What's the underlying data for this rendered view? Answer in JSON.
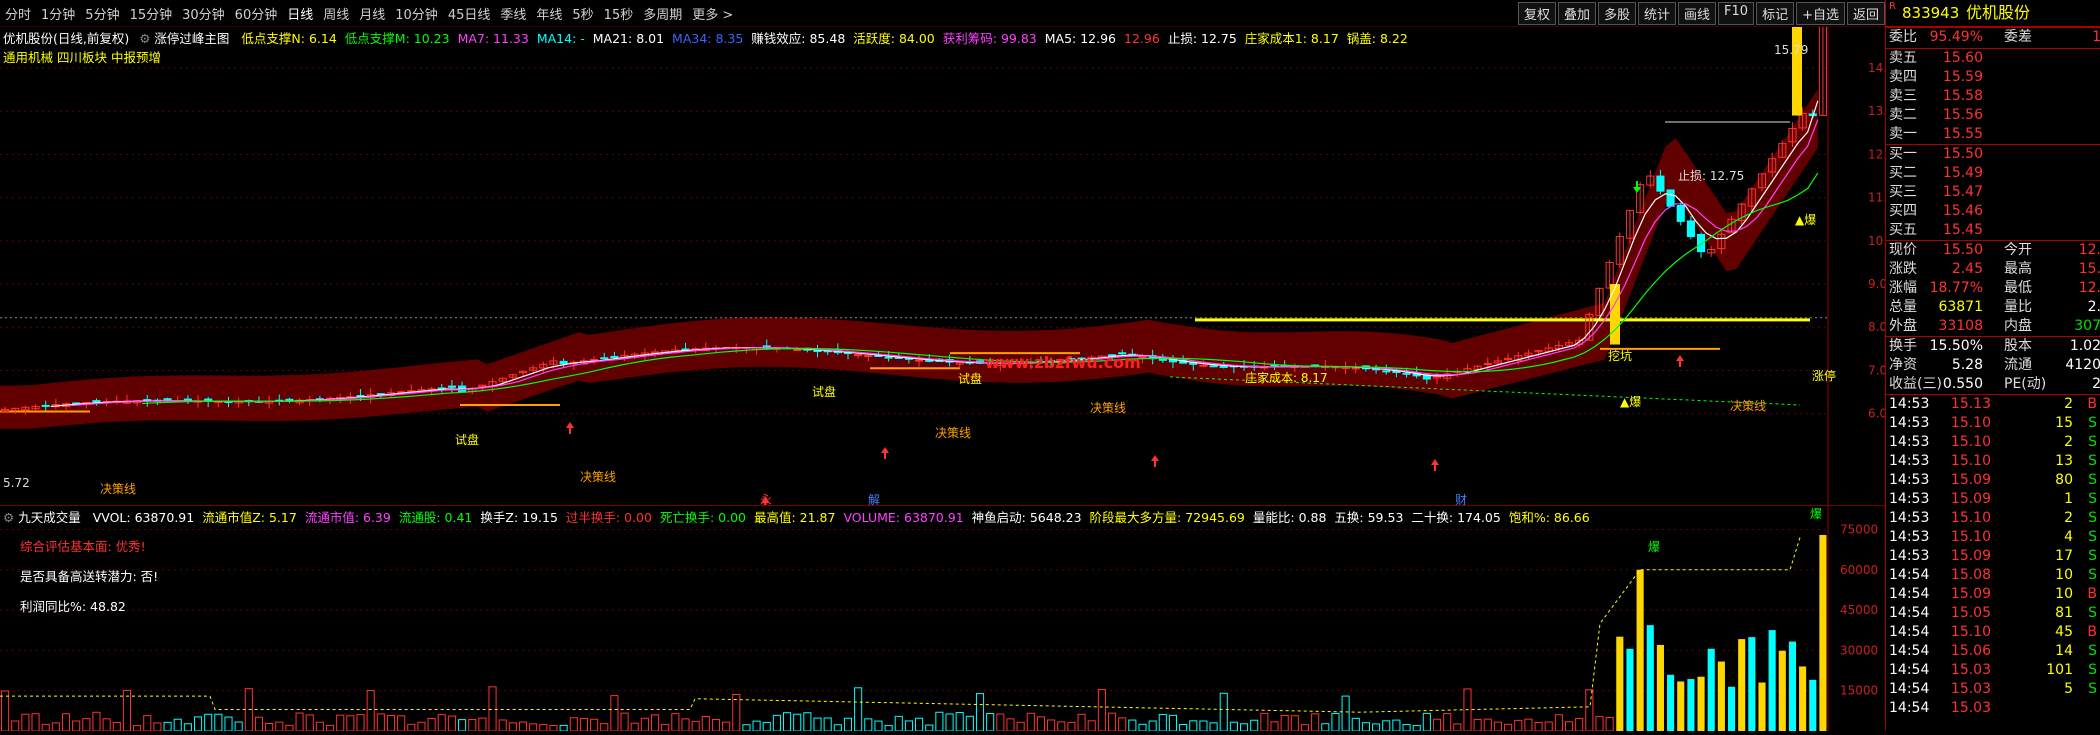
{
  "toolbar": {
    "periods": [
      "分时",
      "1分钟",
      "5分钟",
      "15分钟",
      "30分钟",
      "60分钟",
      "日线",
      "周线",
      "月线",
      "10分钟",
      "45日线",
      "季线",
      "年线",
      "5秒",
      "15秒",
      "多周期",
      "更多 >"
    ],
    "active": "日线",
    "right_buttons": [
      "复权",
      "叠加",
      "多股",
      "统计",
      "画线",
      "F10",
      "标记",
      "+自选",
      "返回"
    ]
  },
  "main": {
    "title": "优机股份(日线,前复权)",
    "formula": "涨停过峰主图",
    "indicators": [
      {
        "text": "低点支撑N: 6.14",
        "color": "#ffff00"
      },
      {
        "text": "低点支撑M: 10.23",
        "color": "#00ff00"
      },
      {
        "text": "MA7: 11.33",
        "color": "#ff40ff"
      },
      {
        "text": "MA14: -",
        "color": "#00ffff"
      },
      {
        "text": "MA21: 8.01",
        "color": "#ffffff"
      },
      {
        "text": "MA34: 8.35",
        "color": "#4060ff"
      },
      {
        "text": "赚钱效应: 85.48",
        "color": "#ffffff"
      },
      {
        "text": "活跃度: 84.00",
        "color": "#ffff00"
      },
      {
        "text": "获利筹码: 99.83",
        "color": "#ff40ff"
      },
      {
        "text": "MA5: 12.96",
        "color": "#ffffff"
      },
      {
        "text": "12.96",
        "color": "#ff3232"
      },
      {
        "text": "止损: 12.75",
        "color": "#ffffff"
      },
      {
        "text": "庄家成本1: 8.17",
        "color": "#ffff00"
      },
      {
        "text": "锅盖: 8.22",
        "color": "#ffff00"
      }
    ],
    "concepts": "通用机械  四川板块  中报预增",
    "watermark": "www.zbzfwu.com",
    "y_ticks": [
      "14.00",
      "13.00",
      "12.00",
      "11.00",
      "10.00",
      "9.00",
      "8.00",
      "7.00",
      "6.00"
    ],
    "high_label": "15.79",
    "low_label": "5.72",
    "stop_label": "止损: 12.75",
    "cost_label": "庄家成本: 8.17",
    "limit_label": "涨停",
    "decision_label": "决策线",
    "trial_label": "试盘",
    "dig_label": "挖坑",
    "blast_label": "▲爆",
    "event_labels": [
      "永",
      "解",
      "财"
    ]
  },
  "indicator_panel": {
    "title": "九天成交量",
    "items": [
      {
        "text": "VVOL: 63870.91",
        "color": "#ffffff"
      },
      {
        "text": "流通市值Z: 5.17",
        "color": "#ffff00"
      },
      {
        "text": "流通市值: 6.39",
        "color": "#ff40ff"
      },
      {
        "text": "流通股: 0.41",
        "color": "#00ff00"
      },
      {
        "text": "换手Z: 19.15",
        "color": "#ffffff"
      },
      {
        "text": "过半换手: 0.00",
        "color": "#ff3232"
      },
      {
        "text": "死亡换手: 0.00",
        "color": "#00ff00"
      },
      {
        "text": "最高值: 21.87",
        "color": "#ffff00"
      },
      {
        "text": "VOLUME: 63870.91",
        "color": "#ff40ff"
      },
      {
        "text": "神鱼启动: 5648.23",
        "color": "#ffffff"
      },
      {
        "text": "阶段最大多方量: 72945.69",
        "color": "#ffff00"
      },
      {
        "text": "量能比: 0.88",
        "color": "#ffffff"
      },
      {
        "text": "五换: 59.53",
        "color": "#ffffff"
      },
      {
        "text": "二十换: 174.05",
        "color": "#ffffff"
      },
      {
        "text": "饱和%: 86.66",
        "color": "#ffff00"
      }
    ],
    "notes": [
      {
        "text": "综合评估基本面: 优秀!",
        "color": "#ff3232"
      },
      {
        "text": "是否具备高送转潜力: 否!",
        "color": "#ffffff"
      },
      {
        "text": "利润同比%: 48.82",
        "color": "#ffffff"
      }
    ],
    "y_ticks": [
      "75000",
      "60000",
      "45000",
      "30000",
      "15000"
    ],
    "burst_label": "爆"
  },
  "quote": {
    "code": "833943",
    "name": "优机股份",
    "weibi_label": "委比",
    "weibi": "95.49%",
    "weicha_label": "委差",
    "weicha": "1",
    "asks": [
      {
        "label": "卖五",
        "price": "15.60",
        "vol": ""
      },
      {
        "label": "卖四",
        "price": "15.59",
        "vol": ""
      },
      {
        "label": "卖三",
        "price": "15.58",
        "vol": ""
      },
      {
        "label": "卖二",
        "price": "15.56",
        "vol": ""
      },
      {
        "label": "卖一",
        "price": "15.55",
        "vol": ""
      }
    ],
    "bids": [
      {
        "label": "买一",
        "price": "15.50",
        "vol": ""
      },
      {
        "label": "买二",
        "price": "15.49",
        "vol": ""
      },
      {
        "label": "买三",
        "price": "15.47",
        "vol": ""
      },
      {
        "label": "买四",
        "price": "15.46",
        "vol": ""
      },
      {
        "label": "买五",
        "price": "15.45",
        "vol": ""
      }
    ],
    "stats": [
      {
        "l1": "现价",
        "v1": "15.50",
        "c1": "red",
        "l2": "今开",
        "v2": "12.",
        "c2": "red"
      },
      {
        "l1": "涨跌",
        "v1": "2.45",
        "c1": "red",
        "l2": "最高",
        "v2": "15.",
        "c2": "red"
      },
      {
        "l1": "涨幅",
        "v1": "18.77%",
        "c1": "red",
        "l2": "最低",
        "v2": "12.",
        "c2": "red"
      },
      {
        "l1": "总量",
        "v1": "63871",
        "c1": "yel",
        "l2": "量比",
        "v2": "2.",
        "c2": "white"
      },
      {
        "l1": "外盘",
        "v1": "33108",
        "c1": "red",
        "l2": "内盘",
        "v2": "307",
        "c2": "green"
      }
    ],
    "stats2": [
      {
        "l1": "换手",
        "v1": "15.50%",
        "c1": "white",
        "l2": "股本",
        "v2": "1.02",
        "c2": "white"
      },
      {
        "l1": "净资",
        "v1": "5.28",
        "c1": "white",
        "l2": "流通",
        "v2": "4120",
        "c2": "white"
      },
      {
        "l1": "收益(三)",
        "v1": "0.550",
        "c1": "white",
        "l2": "PE(动)",
        "v2": "2",
        "c2": "white"
      }
    ],
    "ticks": [
      {
        "time": "14:53",
        "price": "15.13",
        "vol": "2",
        "dir": "B"
      },
      {
        "time": "14:53",
        "price": "15.10",
        "vol": "15",
        "dir": "S"
      },
      {
        "time": "14:53",
        "price": "15.10",
        "vol": "2",
        "dir": "S"
      },
      {
        "time": "14:53",
        "price": "15.10",
        "vol": "13",
        "dir": "S"
      },
      {
        "time": "14:53",
        "price": "15.09",
        "vol": "80",
        "dir": "S"
      },
      {
        "time": "14:53",
        "price": "15.09",
        "vol": "1",
        "dir": "S"
      },
      {
        "time": "14:53",
        "price": "15.10",
        "vol": "2",
        "dir": "S"
      },
      {
        "time": "14:53",
        "price": "15.10",
        "vol": "4",
        "dir": "S"
      },
      {
        "time": "14:53",
        "price": "15.09",
        "vol": "17",
        "dir": "S"
      },
      {
        "time": "14:54",
        "price": "15.08",
        "vol": "10",
        "dir": "S"
      },
      {
        "time": "14:54",
        "price": "15.09",
        "vol": "10",
        "dir": "B"
      },
      {
        "time": "14:54",
        "price": "15.05",
        "vol": "81",
        "dir": "S"
      },
      {
        "time": "14:54",
        "price": "15.10",
        "vol": "45",
        "dir": "B"
      },
      {
        "time": "14:54",
        "price": "15.06",
        "vol": "14",
        "dir": "S"
      },
      {
        "time": "14:54",
        "price": "15.03",
        "vol": "101",
        "dir": "S"
      },
      {
        "time": "14:54",
        "price": "15.03",
        "vol": "5",
        "dir": "S"
      },
      {
        "time": "14:54",
        "price": "15.03",
        "vol": "",
        "dir": ""
      }
    ]
  }
}
